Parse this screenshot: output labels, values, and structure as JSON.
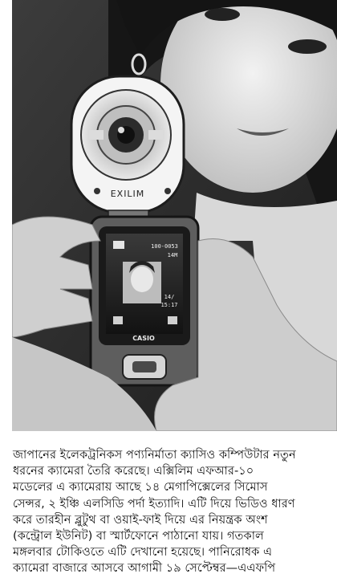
{
  "photo": {
    "camera_brand_label": "EXILIM",
    "device_brand_label": "CASIO",
    "screen_counter": "100-0053",
    "screen_resolution": "14M",
    "screen_date": "14/",
    "screen_time": "15:17"
  },
  "caption": {
    "lines": [
      "জাপানের ইলেকট্রনিকস পণ্যনির্মাতা ক্যাসিও কম্পিউটার নতুন",
      "ধরনের ক্যামেরা তৈরি করেছে। এক্সিলিম এফআর-১০",
      "মডেলের এ ক্যামেরায় আছে ১৪ মেগাপিক্সেলের সিমোস",
      "সেন্সর, ২ ইঞ্চি এলসিডি পর্দা ইত্যাদি। এটি দিয়ে ভিডিও ধারণ",
      "করে তারহীন ব্লুটুথ বা ওয়াই-ফাই দিয়ে এর নিয়ন্ত্রক অংশ",
      "(কন্ট্রোল ইউনিট) বা স্মার্টফোনে পাঠানো যায়। গতকাল",
      "মঙ্গলবার টোকিওতে এটি দেখানো হয়েছে। পানিরোধক এ",
      "ক্যামেরা বাজারে আসবে আগামী ১৯ সেপ্টেম্বর—এএফপি"
    ]
  }
}
